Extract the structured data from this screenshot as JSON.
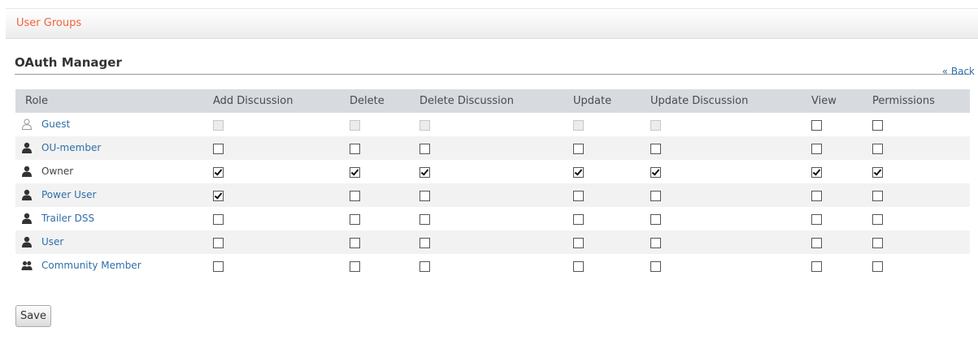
{
  "breadcrumb": {
    "label": "User Groups"
  },
  "page": {
    "title": "OAuth Manager",
    "back_label": "« Back"
  },
  "table": {
    "columns": [
      "Role",
      "Add Discussion",
      "Delete",
      "Delete Discussion",
      "Update",
      "Update Discussion",
      "View",
      "Permissions"
    ],
    "rows": [
      {
        "name": "Guest",
        "icon": "user-outline-icon",
        "link": true,
        "checks": [
          "disabled",
          "disabled",
          "disabled",
          "disabled",
          "disabled",
          "off",
          "off"
        ]
      },
      {
        "name": "OU-member",
        "icon": "user-icon",
        "link": true,
        "checks": [
          "off",
          "off",
          "off",
          "off",
          "off",
          "off",
          "off"
        ]
      },
      {
        "name": "Owner",
        "icon": "user-icon",
        "link": false,
        "checks": [
          "on",
          "on",
          "on",
          "on",
          "on",
          "on",
          "on"
        ]
      },
      {
        "name": "Power User",
        "icon": "user-icon",
        "link": true,
        "checks": [
          "on",
          "off",
          "off",
          "off",
          "off",
          "off",
          "off"
        ]
      },
      {
        "name": "Trailer DSS",
        "icon": "user-icon",
        "link": true,
        "checks": [
          "off",
          "off",
          "off",
          "off",
          "off",
          "off",
          "off"
        ]
      },
      {
        "name": "User",
        "icon": "user-icon",
        "link": true,
        "checks": [
          "off",
          "off",
          "off",
          "off",
          "off",
          "off",
          "off"
        ]
      },
      {
        "name": "Community Member",
        "icon": "users-icon",
        "link": true,
        "checks": [
          "off",
          "off",
          "off",
          "off",
          "off",
          "off",
          "off"
        ]
      }
    ]
  },
  "actions": {
    "save_label": "Save"
  }
}
